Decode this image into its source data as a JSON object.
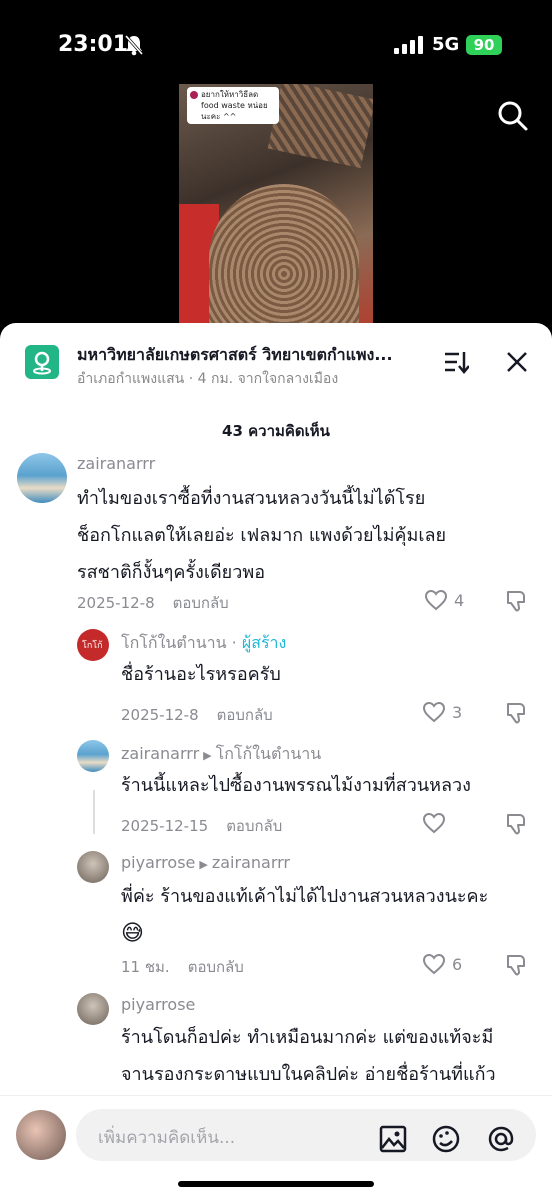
{
  "status": {
    "time": "23:01",
    "network": "5G",
    "battery": "90"
  },
  "video": {
    "caption": "อยากให้หาวิธีลด food waste หน่อยนะคะ ^^"
  },
  "header": {
    "title": "มหาวิทยาลัยเกษตรศาสตร์ วิทยาเขตกำแพง...",
    "subtitle": "อำเภอกำแพงแสน · 4 กม. จากใจกลางเมือง"
  },
  "comment_count": "43 ความคิดเห็น",
  "reply_label": "ตอบกลับ",
  "comments": [
    {
      "user": "zairanarrr",
      "lines": [
        "ทำไมของเราซื้อที่งานสวนหลวงวันนี้ไม่ได้โรย",
        "ช็อกโกแลตให้เลยอ่ะ เฟลมาก แพงด้วยไม่คุ้มเลย",
        "รสชาติก็งั้นๆครั้งเดียวพอ"
      ],
      "date": "2025-12-8",
      "likes": "4"
    },
    {
      "user": "โกโก้ในตำนาน",
      "badge": "ผู้สร้าง",
      "lines": [
        "ชื่อร้านอะไรหรอครับ"
      ],
      "date": "2025-12-8",
      "likes": "3"
    },
    {
      "user": "zairanarrr",
      "reply_to": "โกโก้ในตำนาน",
      "lines": [
        "ร้านนี้แหละไปซื้องานพรรณไม้งามที่สวนหลวง"
      ],
      "date": "2025-12-15",
      "likes": ""
    },
    {
      "user": "piyarrose",
      "reply_to": "zairanarrr",
      "lines": [
        "พี่ค่ะ ร้านของแท้เค้าไม่ได้ไปงานสวนหลวงนะคะ",
        "😅"
      ],
      "date": "11 ชม.",
      "likes": "6"
    },
    {
      "user": "piyarrose",
      "lines": [
        "ร้านโดนก็อปค่ะ ทำเหมือนมากค่ะ แต่ของแท้จะมี",
        "จานรองกระดาษแบบในคลิปค่ะ อ่ายชื่อร้านที่แก้ว"
      ]
    }
  ],
  "input": {
    "placeholder": "เพิ่มความคิดเห็น..."
  },
  "colors": {
    "accent": "#20b8d8",
    "battery": "#2fd158",
    "location_icon": "#22b585"
  }
}
